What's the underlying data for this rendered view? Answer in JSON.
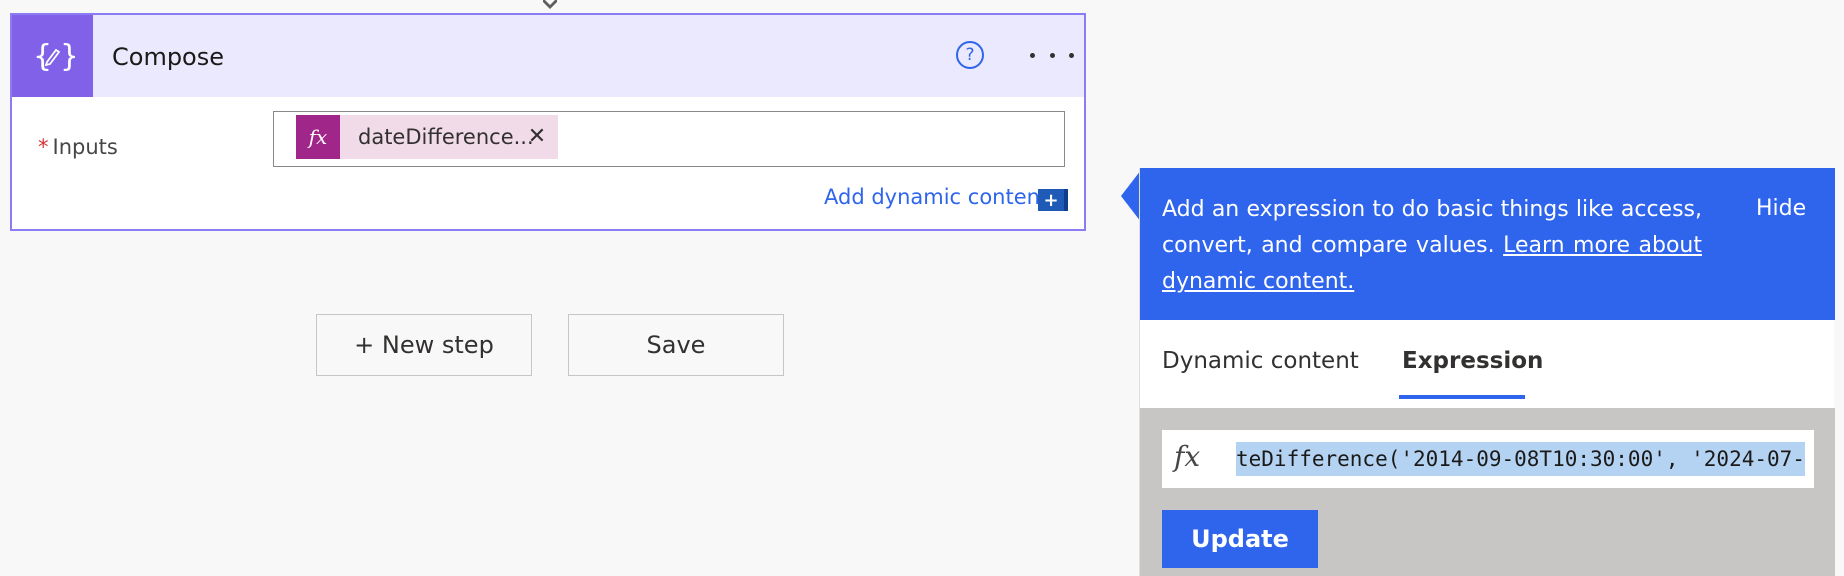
{
  "compose": {
    "title": "Compose",
    "help_glyph": "?",
    "inputs_required_mark": "*",
    "inputs_label": "Inputs",
    "token_label": "dateDifference...",
    "token_fx": "fx",
    "token_remove_glyph": "✕",
    "add_dynamic_label": "Add dynamic content",
    "add_dynamic_glyph": "+"
  },
  "actions": {
    "new_step_label": "+ New step",
    "save_label": "Save"
  },
  "panel": {
    "info_text": "Add an expression to do basic things like access, convert, and compare values.",
    "info_link": "Learn more about dynamic content.",
    "hide_label": "Hide",
    "tabs": [
      {
        "label": "Dynamic content",
        "active": false
      },
      {
        "label": "Expression",
        "active": true
      }
    ],
    "expression_fx": "fx",
    "expression_value": "teDifference('2014-09-08T10:30:00', '2024-07-",
    "update_label": "Update"
  },
  "colors": {
    "accent": "#2f65ed",
    "compose_header": "#ebe9fd",
    "compose_icon": "#8061e8",
    "token_bg": "#f2dbe9",
    "token_icon": "#a0268a"
  },
  "icons": {
    "compose": "curly-braces-pen-icon",
    "help": "question-circle-icon",
    "more": "ellipsis-icon",
    "connector": "arrow-down-icon"
  }
}
